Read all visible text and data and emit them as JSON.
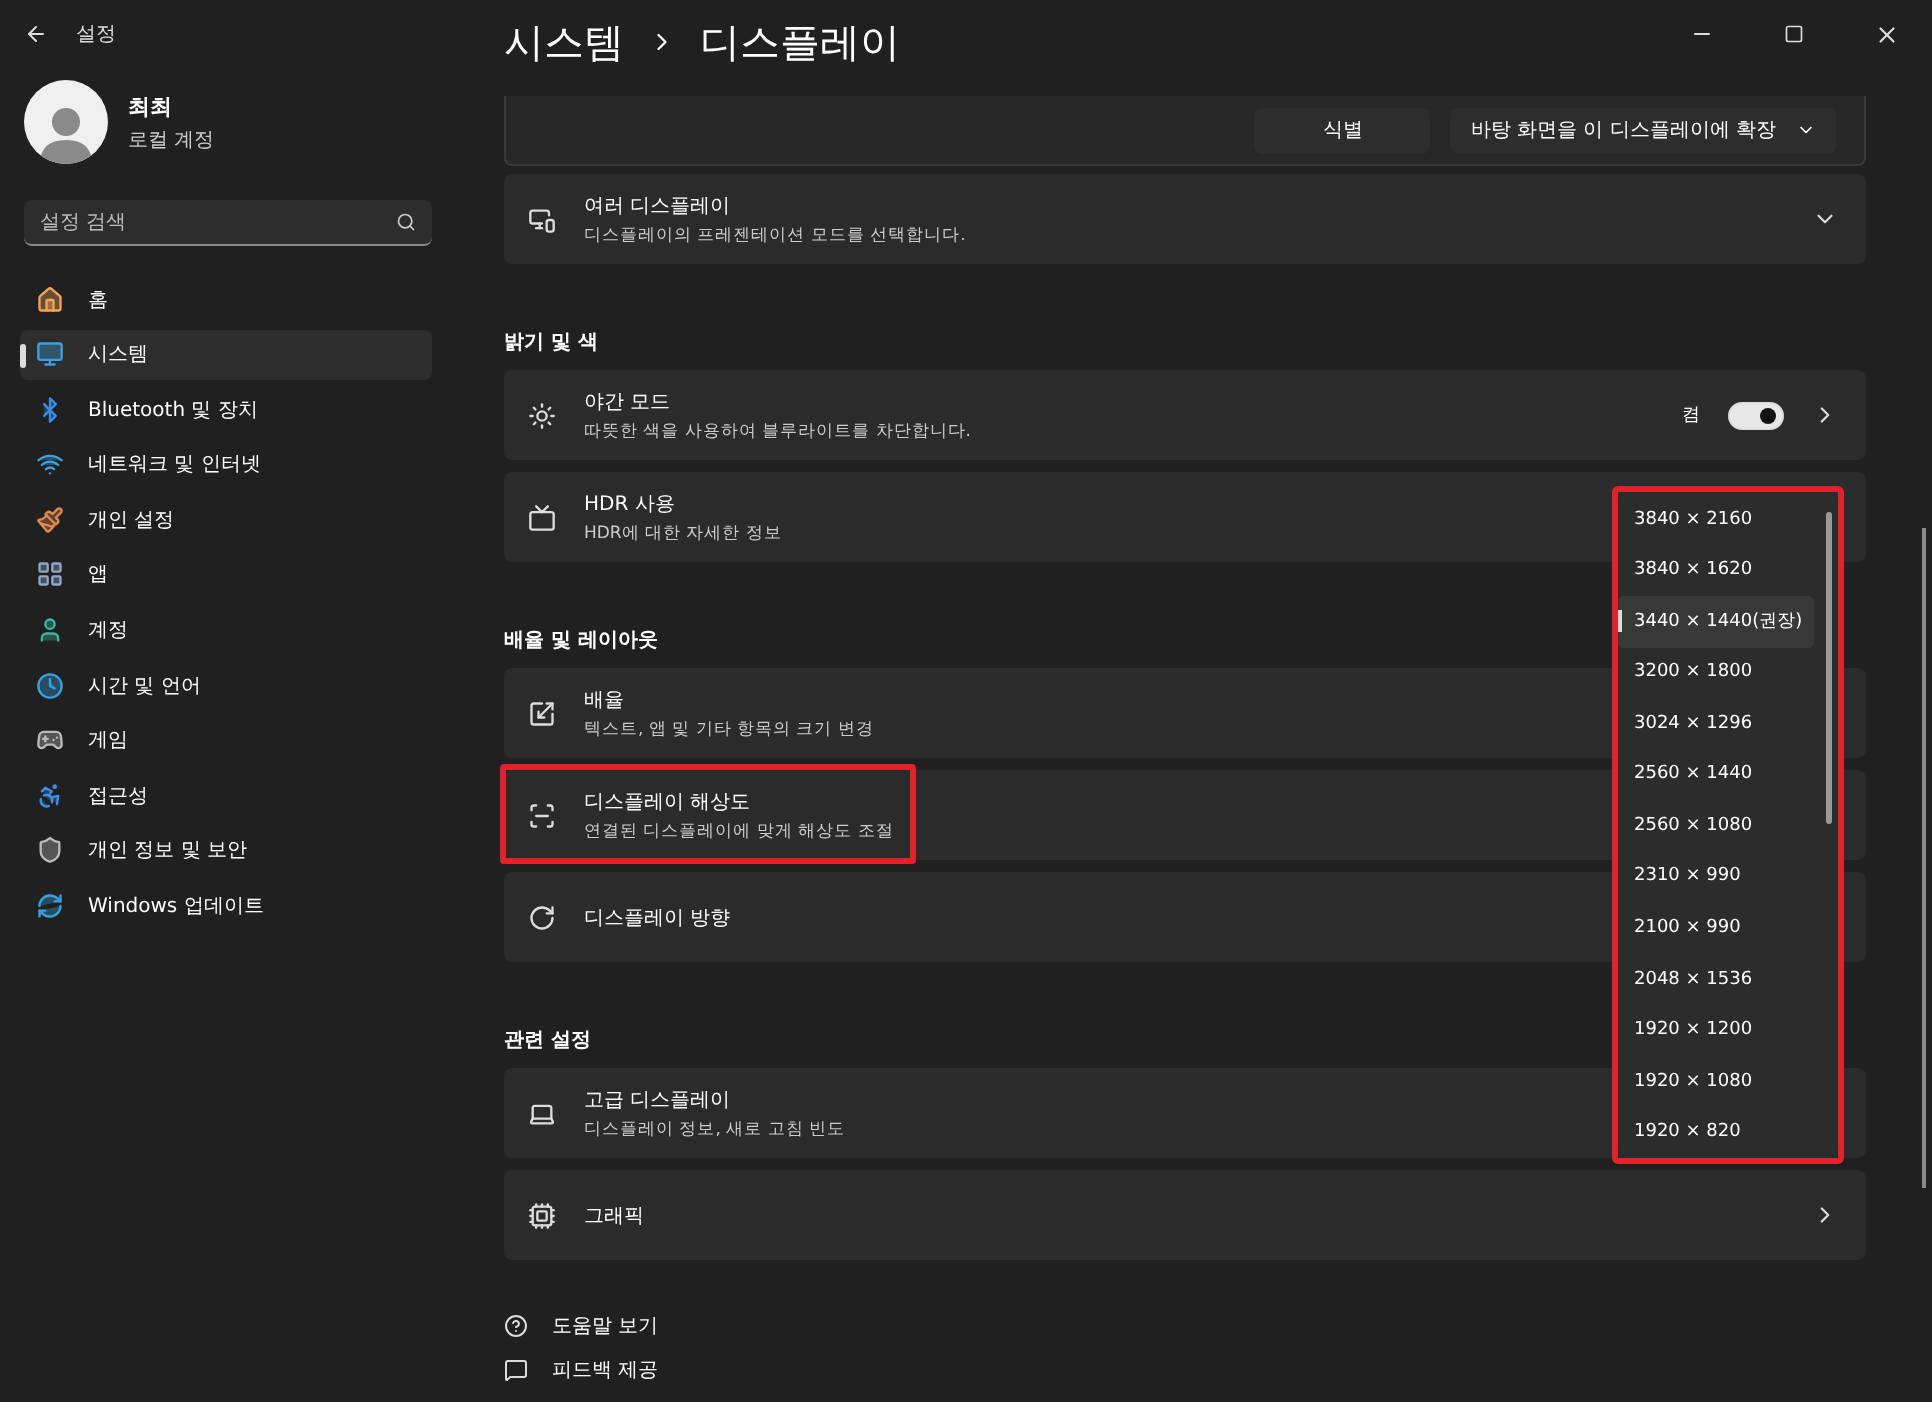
{
  "window": {
    "title": "설정"
  },
  "account": {
    "name": "최최",
    "type": "로컬 계정"
  },
  "search": {
    "placeholder": "설정 검색"
  },
  "nav": [
    {
      "label": "홈",
      "selected": false
    },
    {
      "label": "시스템",
      "selected": true
    },
    {
      "label": "Bluetooth 및 장치",
      "selected": false
    },
    {
      "label": "네트워크 및 인터넷",
      "selected": false
    },
    {
      "label": "개인 설정",
      "selected": false
    },
    {
      "label": "앱",
      "selected": false
    },
    {
      "label": "계정",
      "selected": false
    },
    {
      "label": "시간 및 언어",
      "selected": false
    },
    {
      "label": "게임",
      "selected": false
    },
    {
      "label": "접근성",
      "selected": false
    },
    {
      "label": "개인 정보 및 보안",
      "selected": false
    },
    {
      "label": "Windows 업데이트",
      "selected": false
    }
  ],
  "breadcrumb": [
    "시스템",
    "디스플레이"
  ],
  "top_card": {
    "buttons": [
      "식별"
    ],
    "dropdown": "바탕 화면을 이 디스플레이에 확장"
  },
  "sections": [
    {
      "rows": [
        {
          "kind": "expand",
          "title": "여러 디스플레이",
          "subtitle": "디스플레이의 프레젠테이션 모드를 선택합니다.",
          "highlighted": false
        }
      ]
    },
    {
      "header": "밝기 및 색",
      "rows": [
        {
          "kind": "toggle",
          "title": "야간 모드",
          "subtitle": "따뜻한 색을 사용하여 블루라이트를 차단합니다.",
          "state_label": "켬",
          "on": true,
          "highlighted": false
        },
        {
          "kind": "plain",
          "title": "HDR 사용",
          "subtitle": "HDR에 대한 자세한 정보",
          "highlighted": false
        }
      ]
    },
    {
      "header": "배율 및 레이아웃",
      "rows": [
        {
          "kind": "plain",
          "title": "배율",
          "subtitle": "텍스트, 앱 및 기타 항목의 크기 변경",
          "highlighted": false
        },
        {
          "kind": "plain",
          "title": "디스플레이 해상도",
          "subtitle": "연결된 디스플레이에 맞게 해상도 조절",
          "highlighted": true
        },
        {
          "kind": "plain",
          "title": "디스플레이 방향",
          "highlighted": false
        }
      ]
    },
    {
      "header": "관련 설정",
      "rows": [
        {
          "kind": "plain",
          "title": "고급 디스플레이",
          "subtitle": "디스플레이 정보, 새로 고침 빈도",
          "highlighted": false
        },
        {
          "kind": "link",
          "title": "그래픽",
          "highlighted": false
        }
      ]
    }
  ],
  "footer_links": [
    {
      "label": "도움말 보기"
    },
    {
      "label": "피드백 제공"
    }
  ],
  "resolution_list": {
    "highlighted": true,
    "items": [
      {
        "label": "3840 × 2160",
        "selected": false
      },
      {
        "label": "3840 × 1620",
        "selected": false
      },
      {
        "label": "3440 × 1440(권장)",
        "selected": true
      },
      {
        "label": "3200 × 1800",
        "selected": false
      },
      {
        "label": "3024 × 1296",
        "selected": false
      },
      {
        "label": "2560 × 1440",
        "selected": false
      },
      {
        "label": "2560 × 1080",
        "selected": false
      },
      {
        "label": "2310 × 990",
        "selected": false
      },
      {
        "label": "2100 × 990",
        "selected": false
      },
      {
        "label": "2048 × 1536",
        "selected": false
      },
      {
        "label": "1920 × 1200",
        "selected": false
      },
      {
        "label": "1920 × 1080",
        "selected": false
      },
      {
        "label": "1920 × 820",
        "selected": false
      }
    ]
  }
}
